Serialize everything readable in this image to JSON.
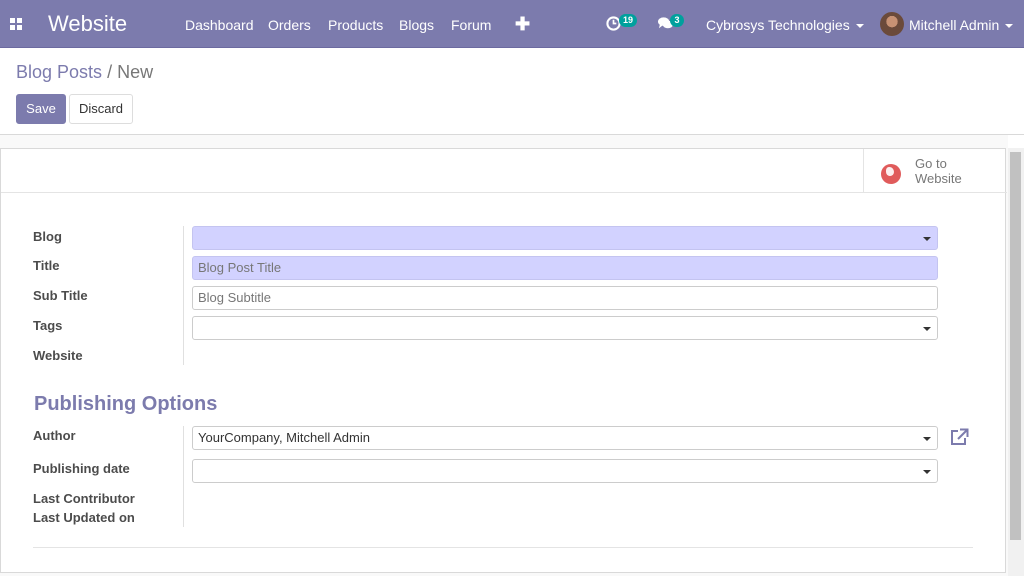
{
  "navbar": {
    "brand": "Website",
    "menu": [
      "Dashboard",
      "Orders",
      "Products",
      "Blogs",
      "Forum"
    ],
    "activity_count": "19",
    "messages_count": "3",
    "company": "Cybrosys Technologies",
    "user": "Mitchell Admin"
  },
  "breadcrumb": {
    "parent": "Blog Posts",
    "separator": "/",
    "current": "New"
  },
  "buttons": {
    "save": "Save",
    "discard": "Discard"
  },
  "button_box": {
    "go_to_website": "Go to Website"
  },
  "form": {
    "blog_label": "Blog",
    "title_label": "Title",
    "title_placeholder": "Blog Post Title",
    "subtitle_label": "Sub Title",
    "subtitle_placeholder": "Blog Subtitle",
    "tags_label": "Tags",
    "website_label": "Website",
    "publishing_section": "Publishing Options",
    "author_label": "Author",
    "author_value": "YourCompany, Mitchell Admin",
    "publishing_date_label": "Publishing date",
    "last_contributor_label": "Last Contributor",
    "last_updated_label": "Last Updated on"
  },
  "colors": {
    "navbar": "#7c7bad",
    "primary": "#7c7bad",
    "required_field": "#d2d2ff",
    "badge": "#00a09d"
  },
  "icons": [
    "apps-icon",
    "plus-icon",
    "activity-clock-icon",
    "chat-icon",
    "globe-icon",
    "external-link-icon"
  ]
}
